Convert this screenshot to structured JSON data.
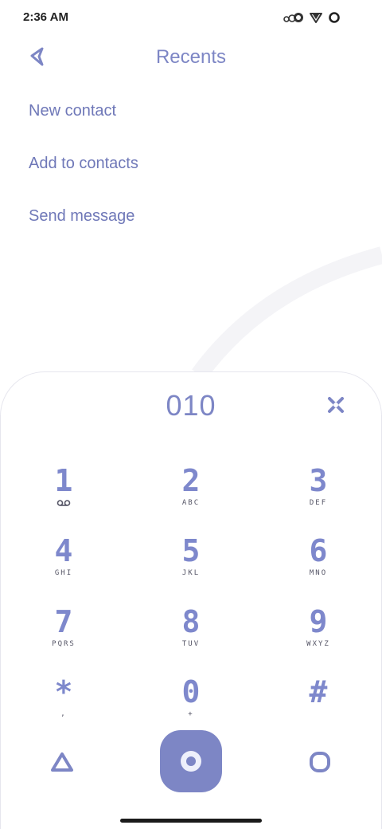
{
  "status_bar": {
    "time": "2:36 AM",
    "icons": [
      "signal-icon",
      "wifi-icon",
      "battery-icon"
    ]
  },
  "header": {
    "title": "Recents",
    "back_icon": "back-arrow-icon"
  },
  "menu": {
    "items": [
      {
        "label": "New contact"
      },
      {
        "label": "Add to contacts"
      },
      {
        "label": "Send message"
      }
    ]
  },
  "dialer": {
    "number": "010",
    "clear_icon": "backspace-icon",
    "keys": [
      {
        "digit": "1",
        "letters": "",
        "sub_icon": "voicemail-icon"
      },
      {
        "digit": "2",
        "letters": "ABC"
      },
      {
        "digit": "3",
        "letters": "DEF"
      },
      {
        "digit": "4",
        "letters": "GHI"
      },
      {
        "digit": "5",
        "letters": "JKL"
      },
      {
        "digit": "6",
        "letters": "MNO"
      },
      {
        "digit": "7",
        "letters": "PQRS"
      },
      {
        "digit": "8",
        "letters": "TUV"
      },
      {
        "digit": "9",
        "letters": "WXYZ"
      },
      {
        "digit": "*",
        "letters": ","
      },
      {
        "digit": "0",
        "letters": "+"
      },
      {
        "digit": "#",
        "letters": ""
      }
    ],
    "bottom_left_icon": "triangle-icon",
    "call_icon": "call-icon",
    "bottom_right_icon": "circle-icon"
  },
  "colors": {
    "accent": "#7d86c5",
    "text_dark": "#222222"
  }
}
